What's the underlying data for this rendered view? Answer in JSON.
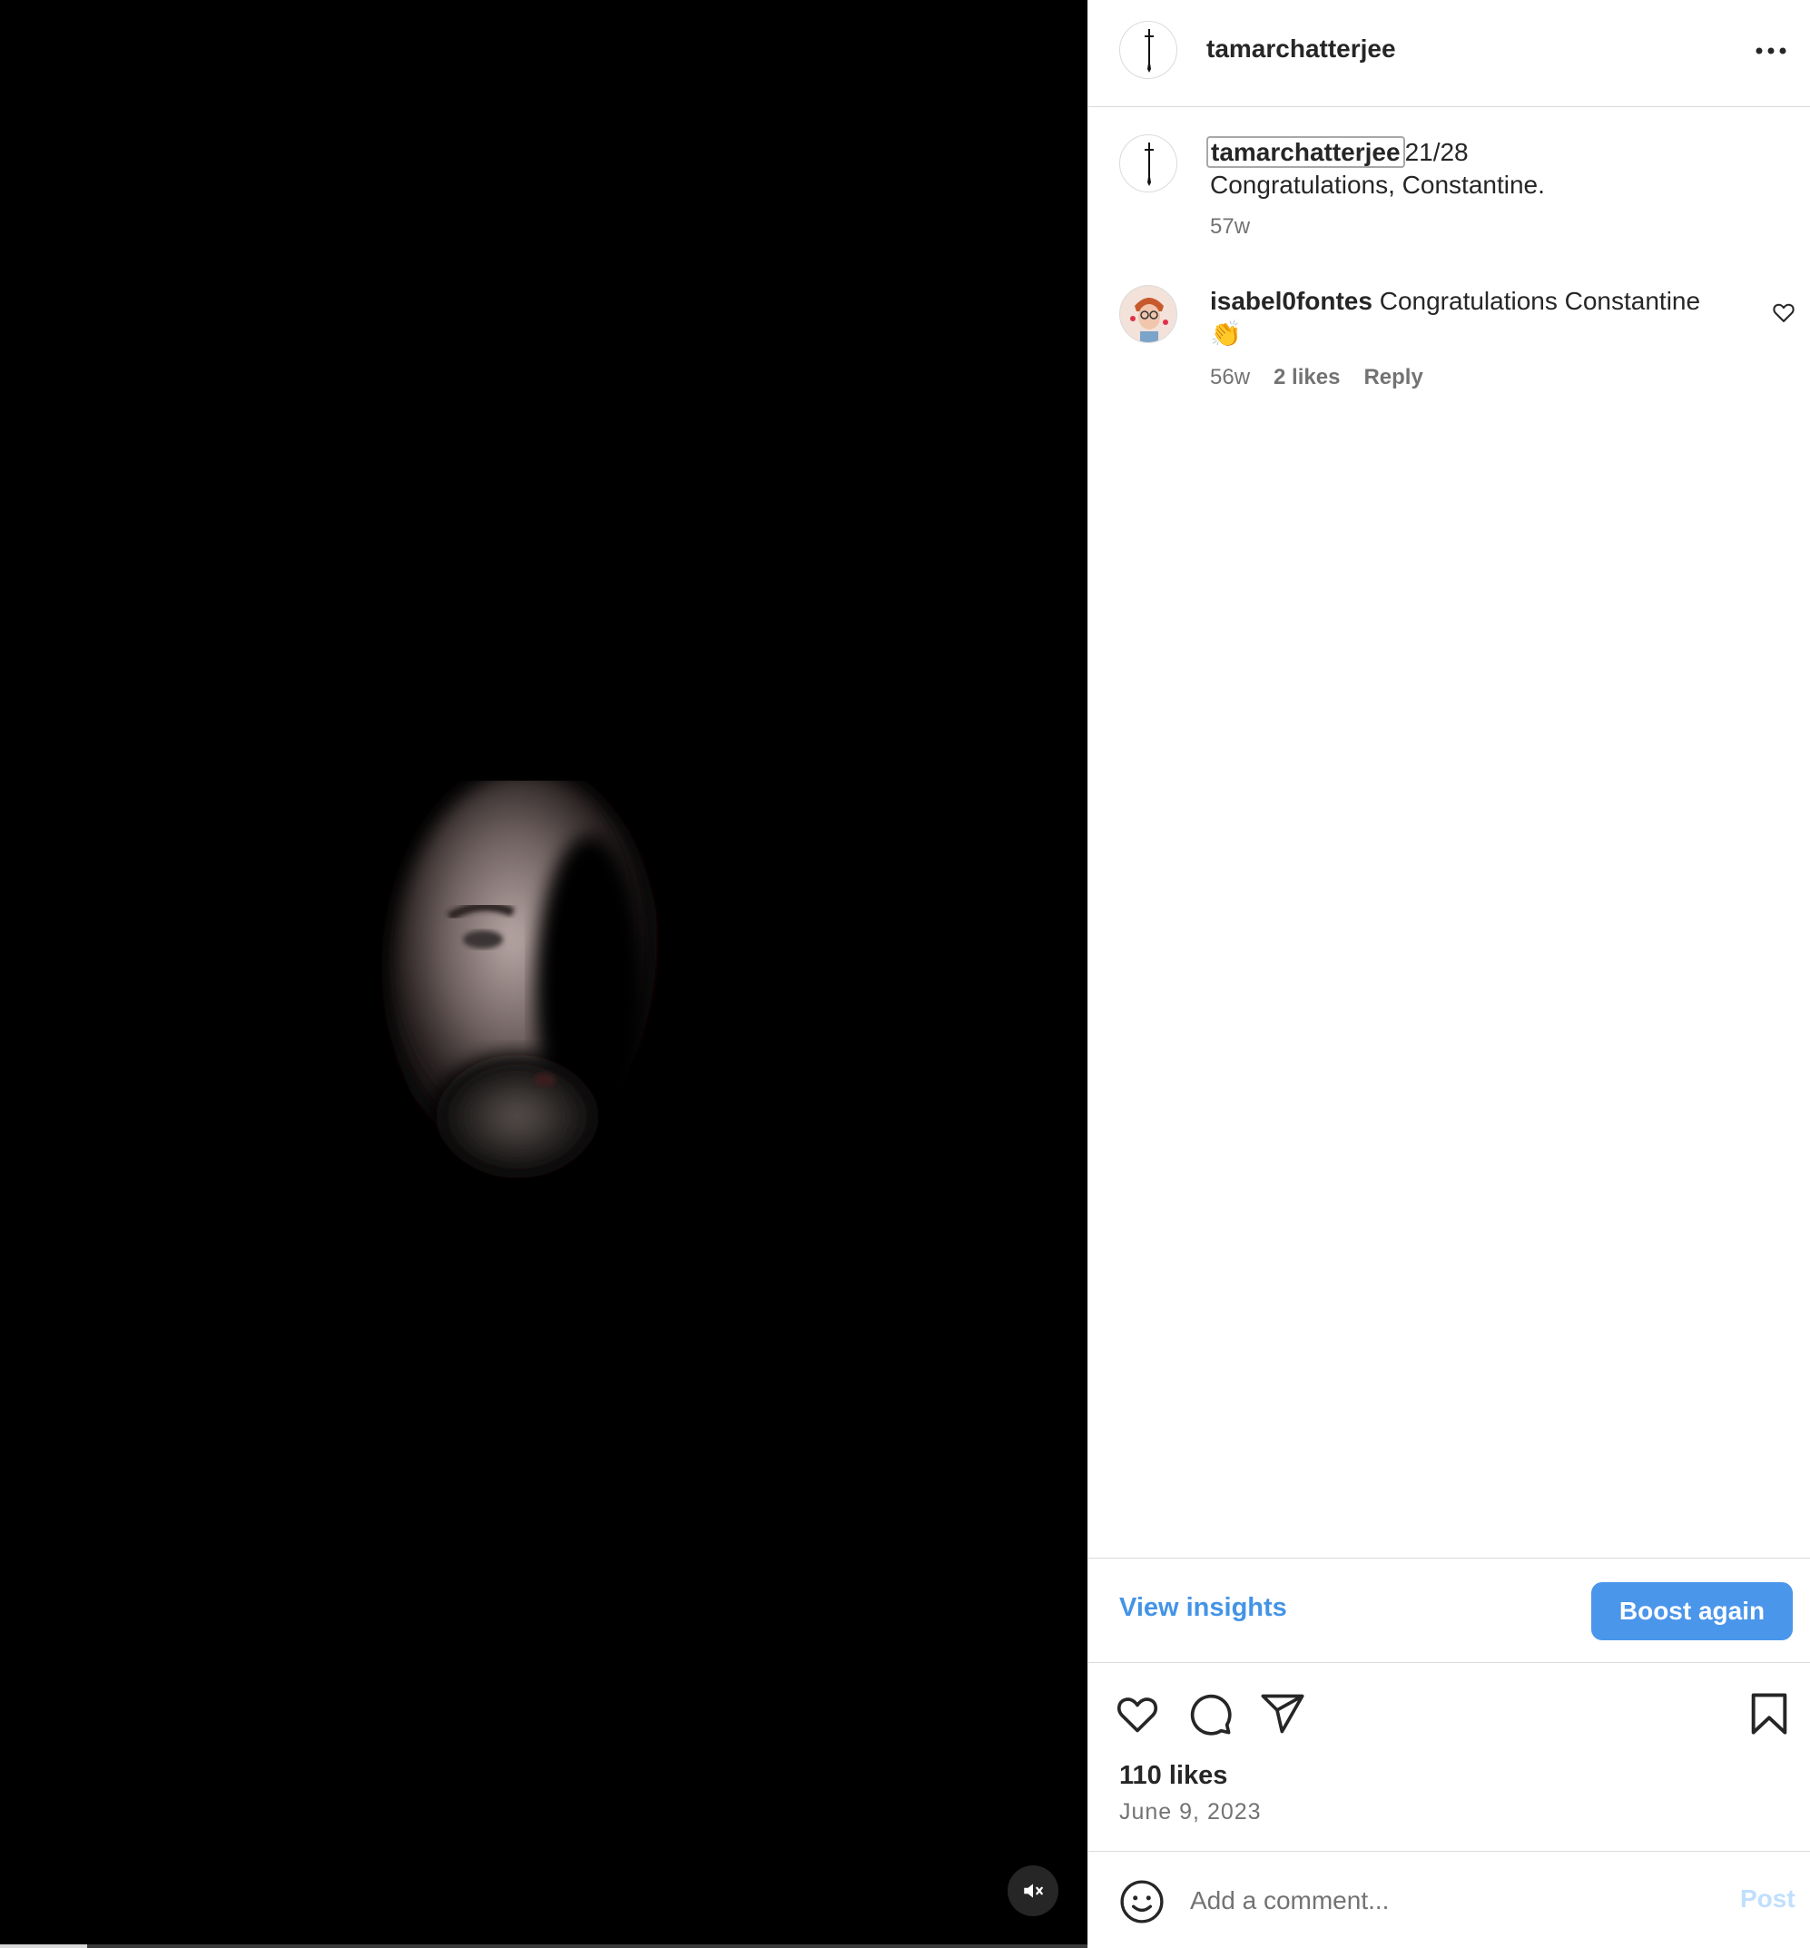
{
  "media": {
    "progress_fraction": 0.08
  },
  "post": {
    "author": "tamarchatterjee",
    "caption_user": "tamarchatterjee",
    "caption_text": "21/28",
    "caption_line2": "Congratulations, Constantine.",
    "caption_time": "57w"
  },
  "comments": [
    {
      "user": "isabel0fontes",
      "text": "Congratulations Constantine",
      "emoji": "👏",
      "time": "56w",
      "likes": "2 likes",
      "reply": "Reply"
    }
  ],
  "insights": {
    "view_label": "View insights",
    "boost_label": "Boost again"
  },
  "stats": {
    "likes": "110 likes",
    "date": "June 9, 2023"
  },
  "composer": {
    "placeholder": "Add a comment...",
    "post_label": "Post"
  },
  "colors": {
    "link_blue": "#4494e6",
    "button_blue": "#4a96ea",
    "post_disabled": "#c0dffd",
    "media_bg": "#000000"
  },
  "icons": [
    "dagger-icon",
    "more-icon",
    "heart-icon",
    "comment-icon",
    "share-icon",
    "bookmark-icon",
    "emoji-icon",
    "mute-icon"
  ]
}
